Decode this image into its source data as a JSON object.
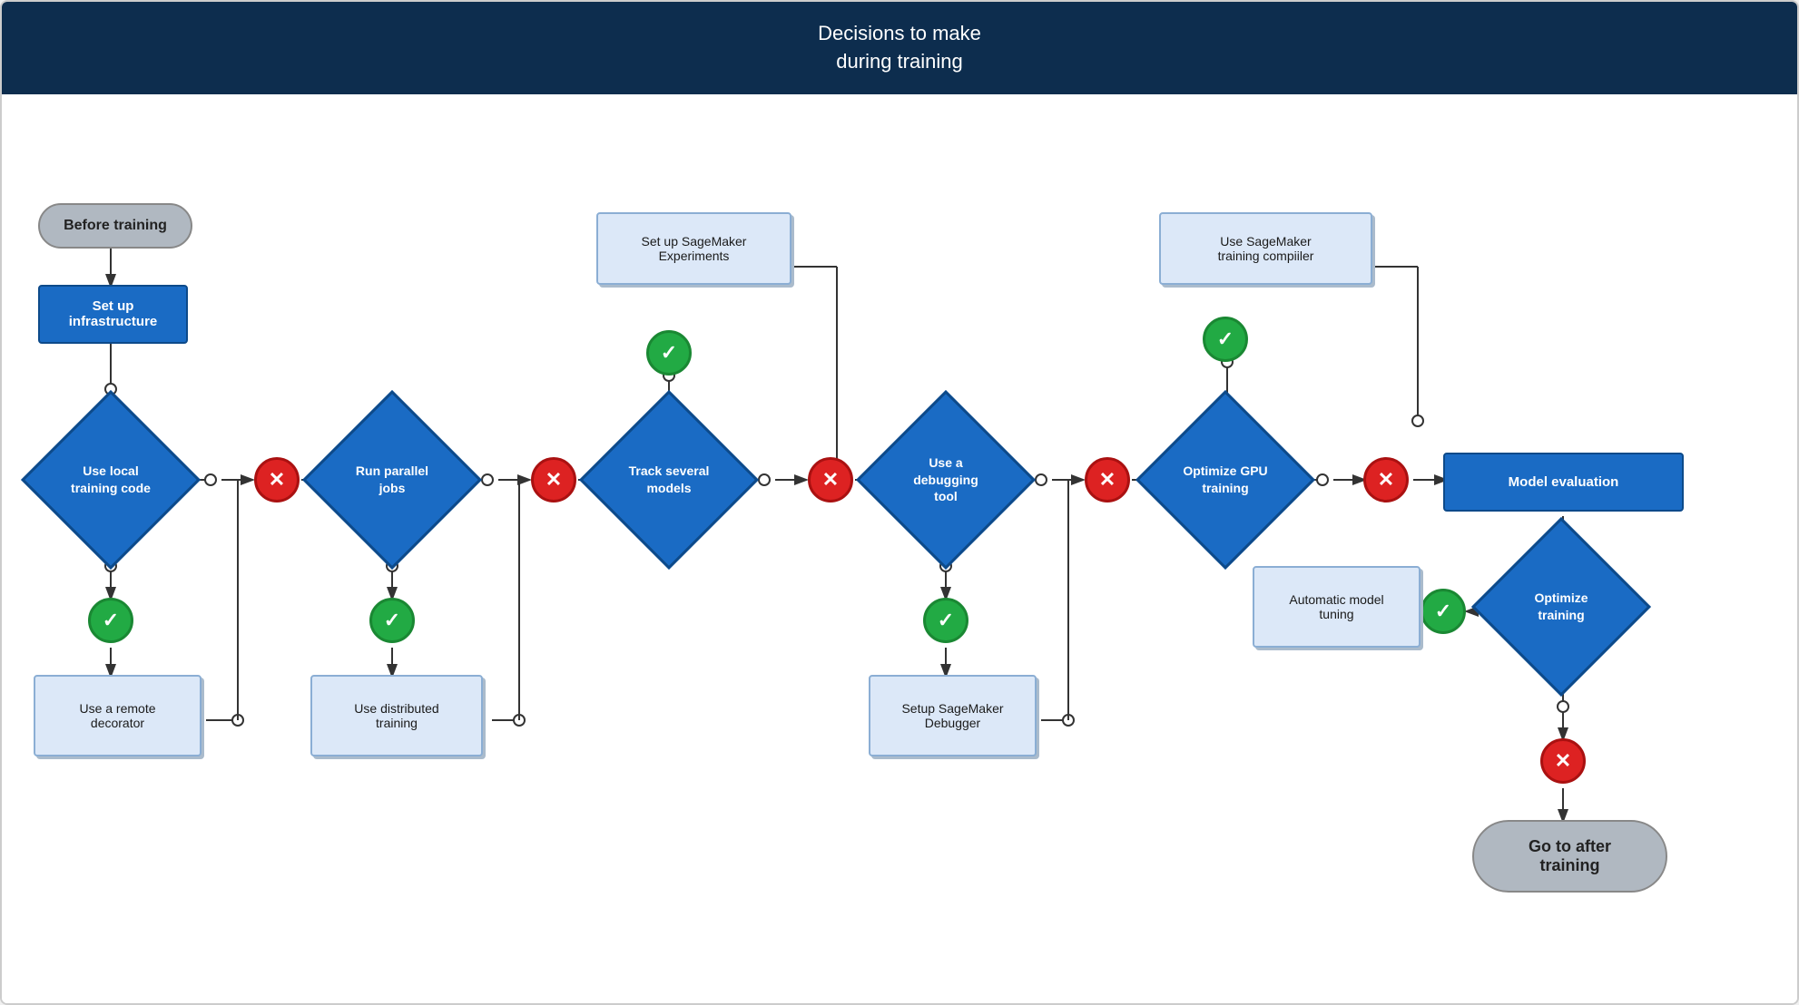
{
  "header": {
    "title": "Decisions to make\nduring training",
    "background": "#0d2d4e"
  },
  "nodes": {
    "before_training": {
      "label": "Before training"
    },
    "set_up_infrastructure": {
      "label": "Set up infrastructure"
    },
    "use_local_training_code": {
      "label": "Use local\ntraining code"
    },
    "use_remote_decorator": {
      "label": "Use a remote\ndecorator"
    },
    "run_parallel_jobs": {
      "label": "Run parallel\njobs"
    },
    "use_distributed_training": {
      "label": "Use distributed\ntraining"
    },
    "track_several_models": {
      "label": "Track several\nmodels"
    },
    "set_up_sagemaker_experiments": {
      "label": "Set up SageMaker\nExperiments"
    },
    "use_debugging_tool": {
      "label": "Use a\ndebugging\ntool"
    },
    "setup_sagemaker_debugger": {
      "label": "Setup SageMaker\nDebugger"
    },
    "optimize_gpu_training": {
      "label": "Optimize GPU\ntraining"
    },
    "use_sagemaker_training_compiler": {
      "label": "Use SageMaker\ntraining compiiler"
    },
    "model_evaluation": {
      "label": "Model evaluation"
    },
    "optimize_training": {
      "label": "Optimize\ntraining"
    },
    "automatic_model_tuning": {
      "label": "Automatic model\ntuning"
    },
    "go_to_after_training": {
      "label": "Go to after\ntraining"
    }
  },
  "colors": {
    "header_bg": "#0d2d4e",
    "blue_node": "#1a6bc4",
    "light_node_bg": "#dce8f8",
    "oval_bg": "#b0b8c1",
    "green": "#22aa44",
    "red": "#dd2222",
    "gray_oval": "#b0b8c1"
  }
}
